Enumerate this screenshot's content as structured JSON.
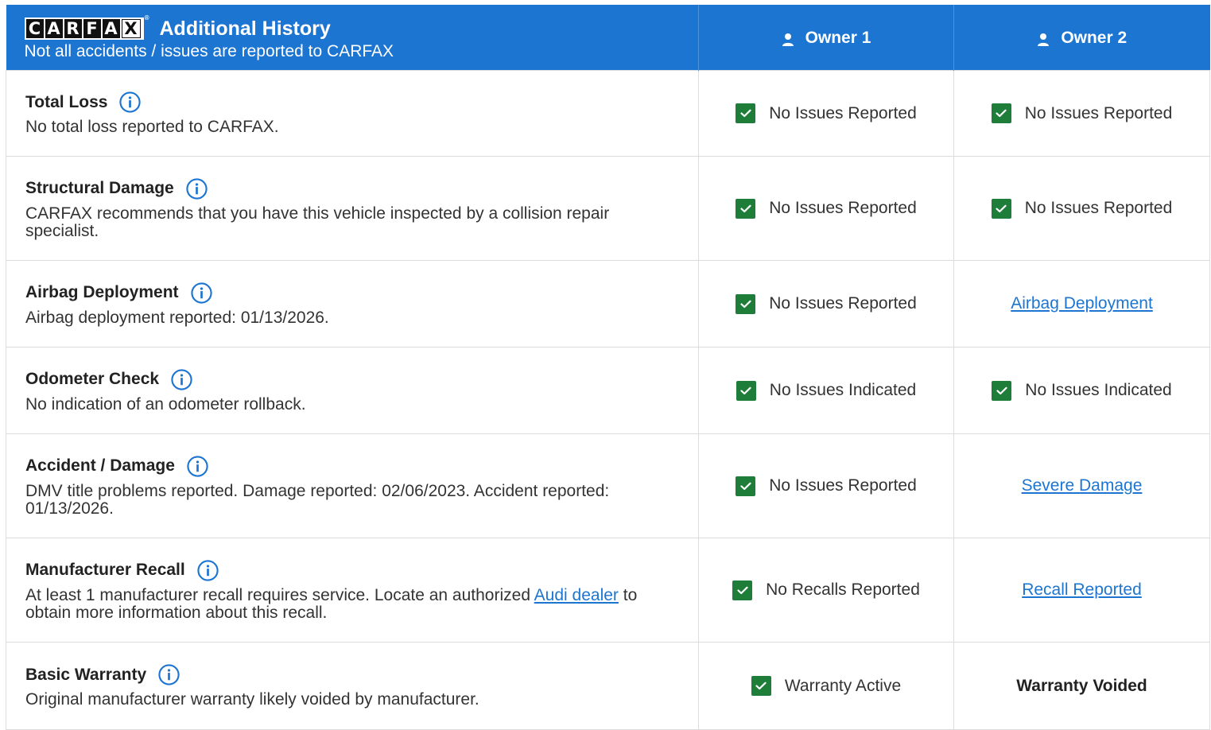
{
  "header": {
    "logo_letters": [
      "C",
      "A",
      "R",
      "F",
      "A",
      "X"
    ],
    "logo_trademark": "®",
    "title": "Additional History",
    "subtitle": "Not all accidents / issues are reported to CARFAX",
    "owners": [
      "Owner 1",
      "Owner 2"
    ]
  },
  "colors": {
    "header_bg": "#1d75d2",
    "check_green": "#1e7d38",
    "link_blue": "#1d75d2",
    "border": "#dcdcdc"
  },
  "rows": [
    {
      "title": "Total Loss",
      "desc": "No total loss reported to CARFAX.",
      "owner1": {
        "type": "check",
        "text": "No Issues Reported"
      },
      "owner2": {
        "type": "check",
        "text": "No Issues Reported"
      }
    },
    {
      "title": "Structural Damage",
      "desc": "CARFAX recommends that you have this vehicle inspected by a collision repair specialist.",
      "owner1": {
        "type": "check",
        "text": "No Issues Reported"
      },
      "owner2": {
        "type": "check",
        "text": "No Issues Reported"
      }
    },
    {
      "title": "Airbag Deployment",
      "desc": "Airbag deployment reported: 01/13/2026.",
      "owner1": {
        "type": "check",
        "text": "No Issues Reported"
      },
      "owner2": {
        "type": "link",
        "text": "Airbag Deployment"
      }
    },
    {
      "title": "Odometer Check",
      "desc": "No indication of an odometer rollback.",
      "owner1": {
        "type": "check",
        "text": "No Issues Indicated"
      },
      "owner2": {
        "type": "check",
        "text": "No Issues Indicated"
      }
    },
    {
      "title": "Accident / Damage",
      "desc": "DMV title problems reported. Damage reported: 02/06/2023. Accident reported: 01/13/2026.",
      "owner1": {
        "type": "check",
        "text": "No Issues Reported"
      },
      "owner2": {
        "type": "link",
        "text": "Severe Damage"
      }
    },
    {
      "title": "Manufacturer Recall",
      "desc_before": "At least 1 manufacturer recall requires service. Locate an authorized ",
      "desc_link": "Audi dealer",
      "desc_after": " to obtain more information about this recall.",
      "owner1": {
        "type": "check",
        "text": "No Recalls Reported"
      },
      "owner2": {
        "type": "link",
        "text": "Recall Reported"
      }
    },
    {
      "title": "Basic Warranty",
      "desc": "Original manufacturer warranty likely voided by manufacturer.",
      "owner1": {
        "type": "check",
        "text": "Warranty Active"
      },
      "owner2": {
        "type": "bold",
        "text": "Warranty Voided"
      }
    }
  ],
  "icons": {
    "info": "info-circle-icon",
    "check": "checkbox-checked-icon",
    "owner": "person-icon"
  }
}
